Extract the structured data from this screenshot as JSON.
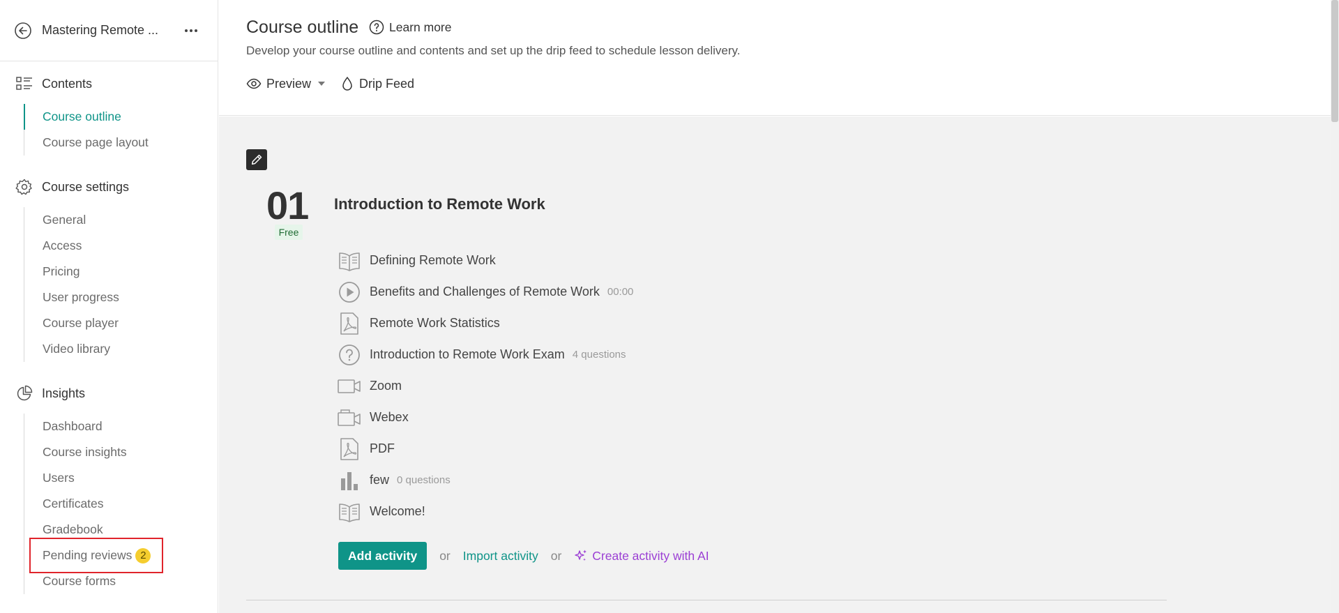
{
  "sidebar": {
    "course_title": "Mastering Remote ...",
    "icons": {
      "back": "back-arrow-icon",
      "more": "more-dots-icon"
    },
    "sections": {
      "contents": {
        "label": "Contents",
        "icon": "list-icon",
        "items": [
          {
            "label": "Course outline",
            "active": true
          },
          {
            "label": "Course page layout"
          }
        ]
      },
      "settings": {
        "label": "Course settings",
        "icon": "gear-icon",
        "items": [
          {
            "label": "General"
          },
          {
            "label": "Access"
          },
          {
            "label": "Pricing"
          },
          {
            "label": "User progress"
          },
          {
            "label": "Course player"
          },
          {
            "label": "Video library"
          }
        ]
      },
      "insights": {
        "label": "Insights",
        "icon": "pie-chart-icon",
        "items": [
          {
            "label": "Dashboard"
          },
          {
            "label": "Course insights"
          },
          {
            "label": "Users"
          },
          {
            "label": "Certificates"
          },
          {
            "label": "Gradebook"
          },
          {
            "label": "Pending reviews",
            "badge": "2"
          },
          {
            "label": "Course forms"
          }
        ]
      }
    }
  },
  "header": {
    "title": "Course outline",
    "learn_more": "Learn more",
    "description": "Develop your course outline and contents and set up the drip feed to schedule lesson delivery.",
    "preview_label": "Preview",
    "drip_feed_label": "Drip Feed"
  },
  "chapter": {
    "number": "01",
    "badge": "Free",
    "title": "Introduction to Remote Work",
    "activities": [
      {
        "title": "Defining Remote Work",
        "meta": "",
        "icon": "book-icon"
      },
      {
        "title": "Benefits and Challenges of Remote Work",
        "meta": "00:00",
        "icon": "play-icon"
      },
      {
        "title": "Remote Work Statistics",
        "meta": "",
        "icon": "pdf-icon"
      },
      {
        "title": "Introduction to Remote Work Exam",
        "meta": "4 questions",
        "icon": "question-icon"
      },
      {
        "title": "Zoom",
        "meta": "",
        "icon": "video-camera-icon"
      },
      {
        "title": "Webex",
        "meta": "",
        "icon": "video-camera-icon"
      },
      {
        "title": "PDF",
        "meta": "",
        "icon": "pdf-icon"
      },
      {
        "title": "few",
        "meta": "0 questions",
        "icon": "bar-chart-icon"
      },
      {
        "title": "Welcome!",
        "meta": "",
        "icon": "book-icon"
      }
    ],
    "add_activity": "Add activity",
    "or1": "or",
    "import_activity": "Import activity",
    "or2": "or",
    "create_ai": "Create activity with AI"
  },
  "colors": {
    "accent": "#0f9488",
    "ai": "#9b3fd4",
    "badge": "#f5cd2e",
    "highlight": "#e0242b"
  }
}
